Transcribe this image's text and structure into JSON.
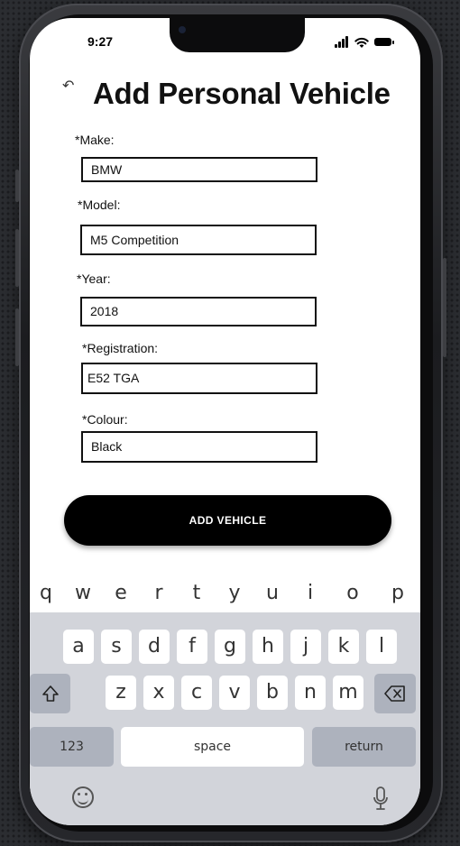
{
  "status": {
    "time": "9:27"
  },
  "page": {
    "title": "Add Personal Vehicle"
  },
  "form": {
    "make": {
      "label": "*Make:",
      "value": "BMW"
    },
    "model": {
      "label": "*Model:",
      "value": "M5 Competition"
    },
    "year": {
      "label": "*Year:",
      "value": "2018"
    },
    "registration": {
      "label": "*Registration:",
      "value": "E52 TGA"
    },
    "colour": {
      "label": "*Colour:",
      "value": "Black"
    },
    "submit_label": "ADD VEHICLE"
  },
  "keyboard": {
    "row1": [
      "q",
      "w",
      "e",
      "r",
      "t",
      "y",
      "u",
      "i",
      "o",
      "p"
    ],
    "row2": [
      "a",
      "s",
      "d",
      "f",
      "g",
      "h",
      "j",
      "k",
      "l"
    ],
    "row3": [
      "z",
      "x",
      "c",
      "v",
      "b",
      "n",
      "m"
    ],
    "numbers_label": "123",
    "space_label": "space",
    "return_label": "return"
  },
  "icons": {
    "back": "back-arrow-icon",
    "signal": "cellular-signal-icon",
    "wifi": "wifi-icon",
    "battery": "battery-icon",
    "shift": "shift-icon",
    "backspace": "backspace-icon",
    "emoji": "emoji-icon",
    "microphone": "microphone-icon"
  },
  "colors": {
    "accent": "#000000",
    "keyboard_bg": "#d2d4da",
    "function_key": "#adb2bd"
  }
}
